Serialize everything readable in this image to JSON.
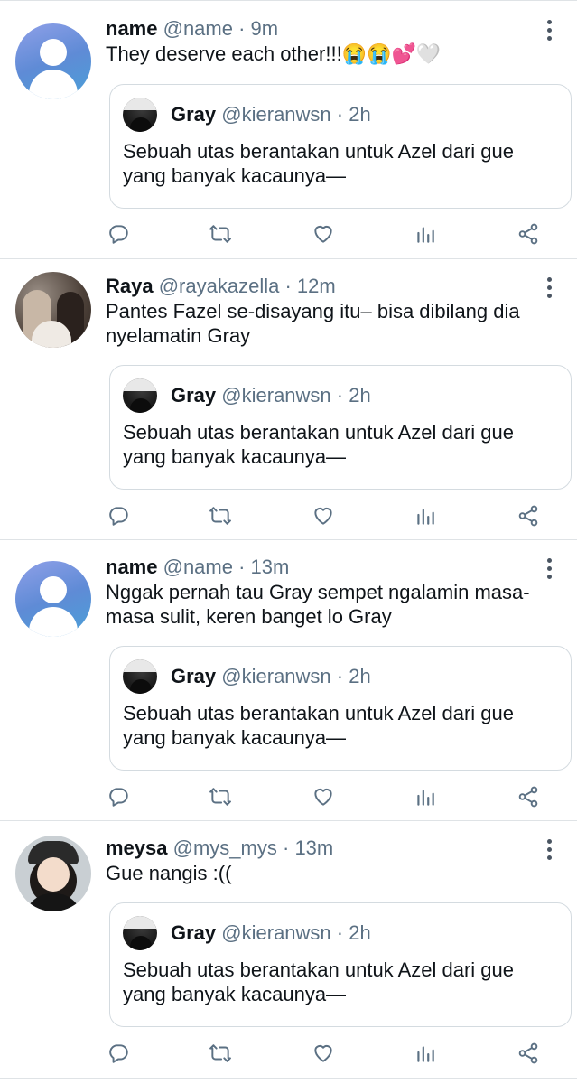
{
  "tweets": [
    {
      "name": "name",
      "handle": "@name",
      "time": "· 9m",
      "avatar": "default-avatar",
      "text": "They deserve each other!!!😭😭💕🤍",
      "quote": {
        "name": "Gray",
        "handle": "@kieranwsn",
        "time": "· 2h",
        "text": "Sebuah utas berantakan untuk Azel dari gue yang banyak kacaunya—"
      }
    },
    {
      "name": "Raya",
      "handle": "@rayakazella",
      "time": "· 12m",
      "avatar": "photo-avatar",
      "text": "Pantes Fazel se-disayang itu– bisa dibilang dia nyelamatin Gray",
      "quote": {
        "name": "Gray",
        "handle": "@kieranwsn",
        "time": "· 2h",
        "text": "Sebuah utas berantakan untuk Azel dari gue yang banyak kacaunya—"
      }
    },
    {
      "name": "name",
      "handle": "@name",
      "time": "· 13m",
      "avatar": "default-avatar",
      "text": "Nggak pernah tau Gray sempet ngalamin masa-masa sulit, keren banget lo Gray",
      "quote": {
        "name": "Gray",
        "handle": "@kieranwsn",
        "time": "· 2h",
        "text": "Sebuah utas berantakan untuk Azel dari gue yang banyak kacaunya—"
      }
    },
    {
      "name": "meysa",
      "handle": "@mys_mys",
      "time": "· 13m",
      "avatar": "photo-avatar",
      "text": "Gue nangis :((",
      "quote": {
        "name": "Gray",
        "handle": "@kieranwsn",
        "time": "· 2h",
        "text": "Sebuah utas berantakan untuk Azel dari gue yang banyak kacaunya—"
      }
    }
  ],
  "icons": {
    "reply": "reply-icon",
    "retweet": "retweet-icon",
    "like": "heart-icon",
    "analytics": "analytics-icon",
    "share": "share-icon",
    "more": "more-vertical-icon"
  },
  "colors": {
    "text": "#0f1419",
    "muted": "#5b7083",
    "icon": "#5b7083",
    "border": "#d4dbe0"
  }
}
